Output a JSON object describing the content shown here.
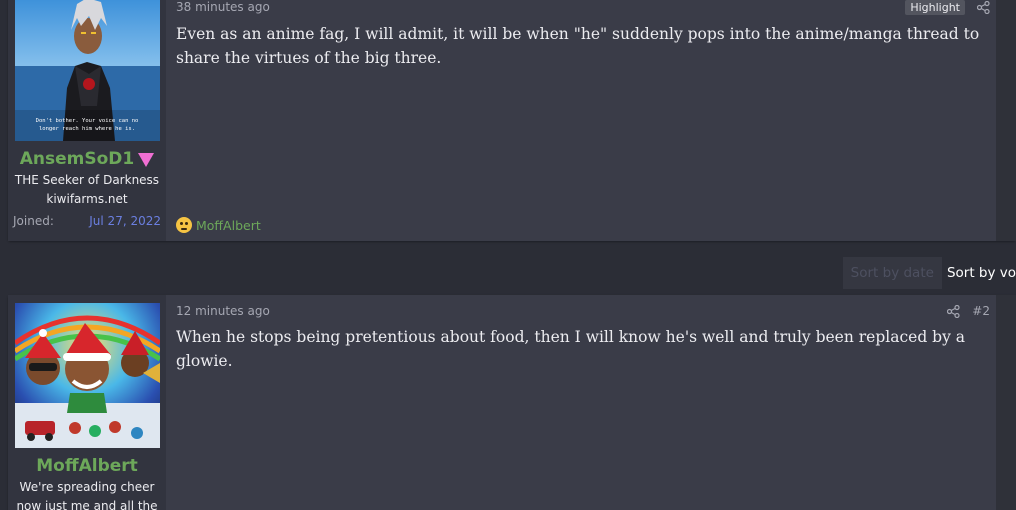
{
  "posts": [
    {
      "username": "AnsemSoD1",
      "user_title_lines": [
        "THE Seeker of Darkness",
        "kiwifarms.net"
      ],
      "joined_label": "Joined:",
      "joined_value": "Jul 27, 2022",
      "avatar_caption": "Don't bother. Your voice can no longer reach him where he is.",
      "time": "38 minutes ago",
      "highlight_label": "Highlight",
      "message": "Even as an anime fag, I will admit, it will be when \"he\" suddenly pops into the anime/manga thread to share the virtues of the big three.",
      "reaction_user": "MoffAlbert",
      "reaction_icon": "thinking-face-icon"
    },
    {
      "username": "MoffAlbert",
      "user_title_lines": [
        "We're spreading cheer",
        "now just me and all the"
      ],
      "time": "12 minutes ago",
      "post_number": "#2",
      "message": "When he stops being pretentious about food, then I will know he's well and truly been replaced by a glowie."
    }
  ],
  "sort": {
    "by_date": "Sort by date",
    "by_votes": "Sort by vo"
  },
  "colors": {
    "username": "#6da85a",
    "joined_date": "#6b7fe0",
    "badge": "#f06fd3",
    "background": "#2b2d36",
    "post_bg": "#3a3c48"
  }
}
